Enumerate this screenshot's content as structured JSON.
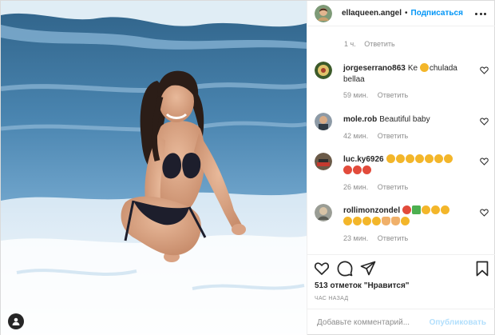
{
  "header": {
    "username": "ellaqueen.angel",
    "separator": "•",
    "follow_label": "Подписаться"
  },
  "previous_comment": {
    "time": "1 ч.",
    "reply_label": "Ответить"
  },
  "comments": [
    {
      "username": "jorgeserrano863",
      "text_before": "Ke",
      "text_after": "chulada bellaa",
      "time": "59 мин.",
      "reply_label": "Ответить"
    },
    {
      "username": "mole.rob",
      "text": "Beautiful baby",
      "time": "42 мин.",
      "reply_label": "Ответить"
    },
    {
      "username": "luc.ky6926",
      "time": "26 мин.",
      "reply_label": "Ответить"
    },
    {
      "username": "rollimonzondel",
      "time": "23 мин.",
      "reply_label": "Ответить"
    }
  ],
  "footer": {
    "likes": "513 отметок \"Нравится\"",
    "posted_ago": "ЧАС НАЗАД",
    "comment_placeholder": "Добавьте комментарий...",
    "post_label": "Опубликовать"
  },
  "icons": {
    "like": "heart-icon",
    "comment": "comment-icon",
    "share": "paper-plane-icon",
    "save": "bookmark-icon",
    "tag": "user-tag-icon",
    "more": "more-options-icon",
    "comment_like": "heart-outline-icon"
  },
  "colors": {
    "follow": "#0095f6",
    "muted": "#8e8e8e",
    "post_disabled": "#b2dffc"
  }
}
